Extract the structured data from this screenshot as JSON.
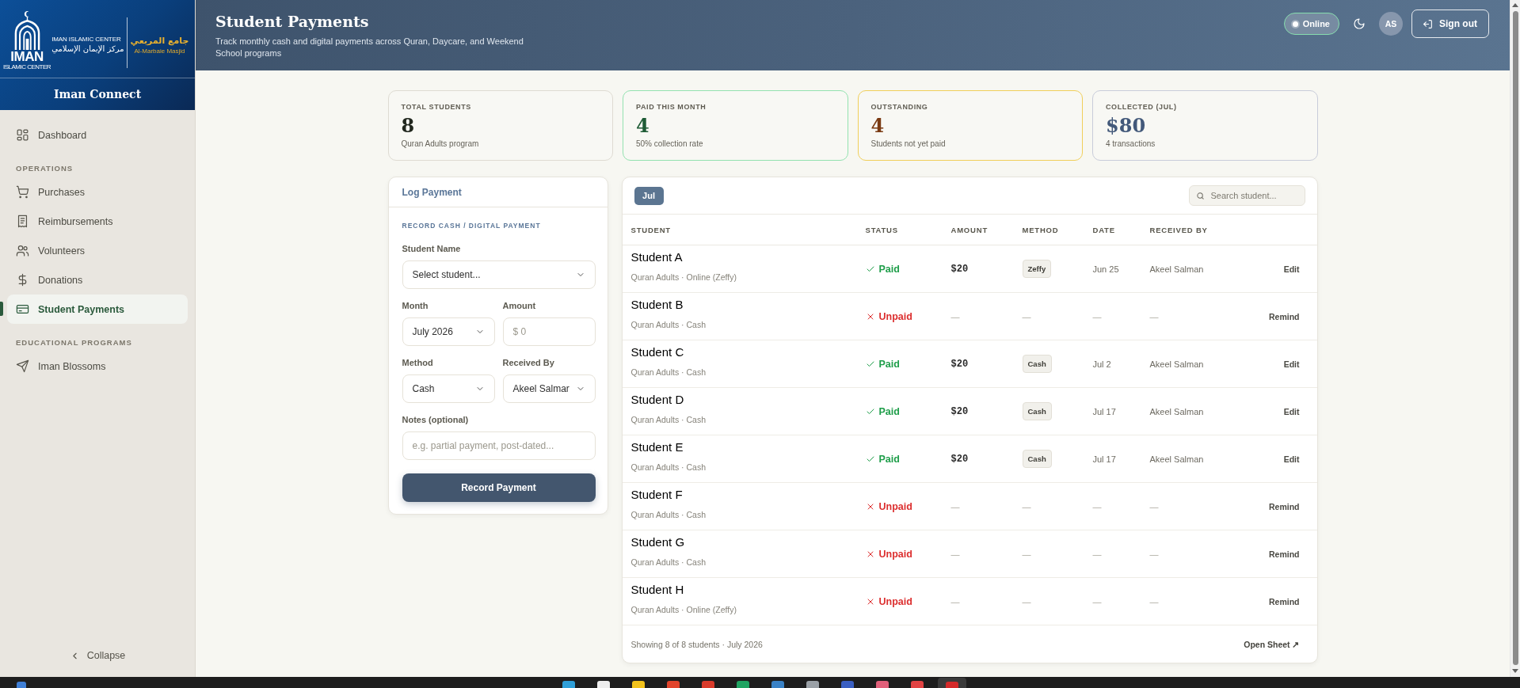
{
  "sidebar": {
    "logo": {
      "mark": "IMAN",
      "mark_caption": "ISLAMIC CENTER",
      "name": "IMAN ISLAMIC CENTER",
      "name_arabic": "مركز الإيمان الإسلامي",
      "masjid_arabic": "جامع المربعي",
      "masjid": "Al-Marbaie Masjid"
    },
    "app_name": "Iman Connect",
    "sections": [
      {
        "items": [
          {
            "label": "Dashboard",
            "selected": false
          }
        ]
      },
      {
        "heading": "OPERATIONS",
        "items": [
          {
            "label": "Purchases",
            "selected": false
          },
          {
            "label": "Reimbursements",
            "selected": false
          },
          {
            "label": "Volunteers",
            "selected": false
          },
          {
            "label": "Donations",
            "selected": false
          },
          {
            "label": "Student Payments",
            "selected": true
          }
        ]
      },
      {
        "heading": "EDUCATIONAL PROGRAMS",
        "items": [
          {
            "label": "Iman Blossoms",
            "selected": false
          }
        ]
      }
    ],
    "collapse": "Collapse"
  },
  "header": {
    "title": "Student Payments",
    "subtitle": "Track monthly cash and digital payments across Quran, Daycare, and Weekend School programs",
    "status": {
      "label": "Online",
      "on": true
    },
    "avatar": "AS",
    "sign_out": "Sign out"
  },
  "stats": [
    {
      "kind": "total",
      "label": "TOTAL STUDENTS",
      "value": "8",
      "note": "Quran Adults program"
    },
    {
      "kind": "paid",
      "label": "PAID THIS MONTH",
      "value": "4",
      "note": "50% collection rate"
    },
    {
      "kind": "outstanding",
      "label": "OUTSTANDING",
      "value": "4",
      "note": "Students not yet paid"
    },
    {
      "kind": "collected",
      "label": "COLLECTED (JUL)",
      "value": "$80",
      "note": "4 transactions"
    }
  ],
  "payment_form": {
    "title": "Log Payment",
    "section": "RECORD CASH / DIGITAL PAYMENT",
    "rows": [
      [
        {
          "kind": "select",
          "label": "Student Name",
          "value": "Select student..."
        }
      ],
      [
        {
          "kind": "select",
          "label": "Month",
          "value": "July 2026"
        },
        {
          "kind": "input",
          "label": "Amount",
          "placeholder": "$ 0"
        }
      ],
      [
        {
          "kind": "select",
          "label": "Method",
          "value": "Cash"
        },
        {
          "kind": "select",
          "label": "Received By",
          "value": "Akeel Salmar"
        }
      ],
      [
        {
          "kind": "input",
          "label": "Notes (optional)",
          "placeholder": "e.g. partial payment, post-dated..."
        }
      ]
    ],
    "submit": "Record Payment"
  },
  "payments_table": {
    "months": [
      {
        "label": "Jul",
        "selected": true
      }
    ],
    "search": {
      "placeholder": "Search student..."
    },
    "columns": [
      "STUDENT",
      "STATUS",
      "AMOUNT",
      "METHOD",
      "DATE",
      "RECEIVED BY"
    ],
    "rows": [
      {
        "name": "Student A",
        "details": "Quran Adults · Online (Zeffy)",
        "status": {
          "kind": "paid",
          "label": "Paid"
        },
        "amount": "$20",
        "method": "Zeffy",
        "date": "Jun 25",
        "received_by": "Akeel Salman",
        "action": "Edit"
      },
      {
        "name": "Student B",
        "details": "Quran Adults · Cash",
        "status": {
          "kind": "unpaid",
          "label": "Unpaid"
        },
        "amount": "—",
        "method": "—",
        "date": "—",
        "received_by": "—",
        "action": "Remind"
      },
      {
        "name": "Student C",
        "details": "Quran Adults · Cash",
        "status": {
          "kind": "paid",
          "label": "Paid"
        },
        "amount": "$20",
        "method": "Cash",
        "date": "Jul 2",
        "received_by": "Akeel Salman",
        "action": "Edit"
      },
      {
        "name": "Student D",
        "details": "Quran Adults · Cash",
        "status": {
          "kind": "paid",
          "label": "Paid"
        },
        "amount": "$20",
        "method": "Cash",
        "date": "Jul 17",
        "received_by": "Akeel Salman",
        "action": "Edit"
      },
      {
        "name": "Student E",
        "details": "Quran Adults · Cash",
        "status": {
          "kind": "paid",
          "label": "Paid"
        },
        "amount": "$20",
        "method": "Cash",
        "date": "Jul 17",
        "received_by": "Akeel Salman",
        "action": "Edit"
      },
      {
        "name": "Student F",
        "details": "Quran Adults · Cash",
        "status": {
          "kind": "unpaid",
          "label": "Unpaid"
        },
        "amount": "—",
        "method": "—",
        "date": "—",
        "received_by": "—",
        "action": "Remind"
      },
      {
        "name": "Student G",
        "details": "Quran Adults · Cash",
        "status": {
          "kind": "unpaid",
          "label": "Unpaid"
        },
        "amount": "—",
        "method": "—",
        "date": "—",
        "received_by": "—",
        "action": "Remind"
      },
      {
        "name": "Student H",
        "details": "Quran Adults · Online (Zeffy)",
        "status": {
          "kind": "unpaid",
          "label": "Unpaid"
        },
        "amount": "—",
        "method": "—",
        "date": "—",
        "received_by": "—",
        "action": "Remind"
      }
    ],
    "footer": {
      "summary": "Showing 8 of 8 students · July 2026",
      "link": "Open Sheet ↗"
    }
  }
}
